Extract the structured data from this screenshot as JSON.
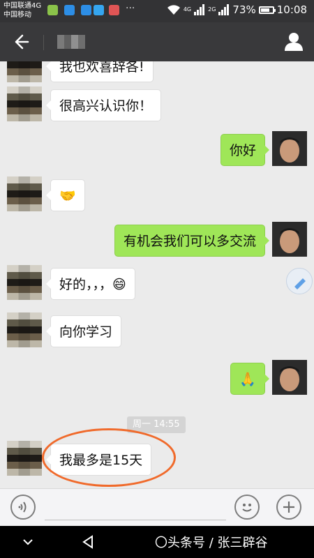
{
  "status_bar": {
    "carrier_primary": "中国联通4G",
    "carrier_secondary": "中国移动",
    "overflow": "···",
    "net_tag_1": "4G",
    "net_tag_2": "2G",
    "battery_text": "73%",
    "battery_level": 0.73,
    "time": "10:08",
    "app_icon_colors": [
      "#8bc34a",
      "#2d8ee6",
      "#2d8ee6",
      "#35a6f0",
      "#e05555"
    ]
  },
  "nav_bar": {
    "contact_name": "",
    "background": "#39393b"
  },
  "messages": [
    {
      "side": "in",
      "text": "我也欢喜辞各!"
    },
    {
      "side": "in",
      "text": "很高兴认识你！"
    },
    {
      "side": "out",
      "text": "你好"
    },
    {
      "side": "in",
      "text": "🤝"
    },
    {
      "side": "out",
      "text": "有机会我们可以多交流"
    },
    {
      "side": "in",
      "text": "好的，，，😄"
    },
    {
      "side": "in",
      "text": "向你学习"
    },
    {
      "side": "out",
      "text": "🙏"
    },
    {
      "side": "in",
      "text": "我最多是15天"
    }
  ],
  "timestamp": "周一 14:55",
  "input_bar": {
    "text_value": ""
  },
  "watermark": "〇头条号 / 张三辟谷",
  "colors": {
    "bubble_out": "#9fe658",
    "bubble_in": "#ffffff",
    "highlight": "#f06a2b",
    "chat_bg": "#ebebeb"
  }
}
